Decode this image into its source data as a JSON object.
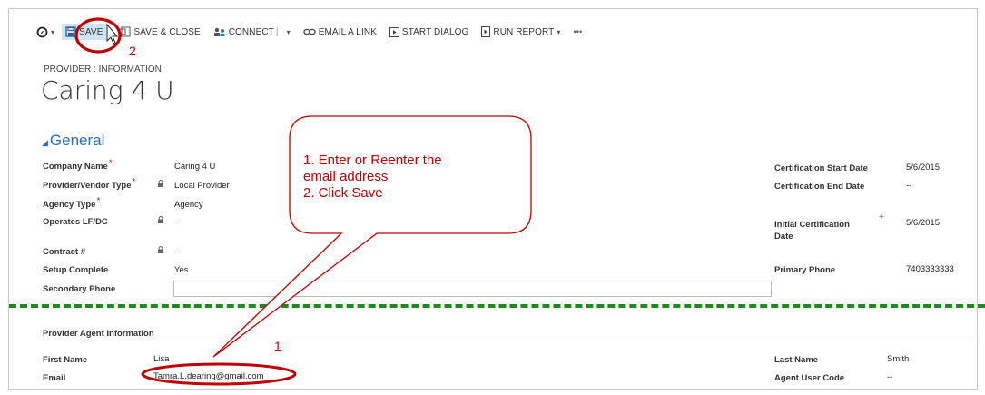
{
  "toolbar": {
    "save": "SAVE",
    "save_close": "SAVE & CLOSE",
    "connect": "CONNECT",
    "email_link": "EMAIL A LINK",
    "start_dialog": "START DIALOG",
    "run_report": "RUN REPORT",
    "more": "•••"
  },
  "header": {
    "entity_label": "PROVIDER : INFORMATION",
    "title": "Caring 4 U"
  },
  "section_general": {
    "title": "General",
    "left": [
      {
        "label": "Company Name",
        "required": "*",
        "value": "Caring 4 U"
      },
      {
        "label": "Provider/Vendor Type",
        "required": "*",
        "value": "Local Provider"
      },
      {
        "label": "Agency Type",
        "required": "*",
        "value": "Agency"
      },
      {
        "label": "Operates LF/DC",
        "value": "--"
      },
      {
        "label": "Contract #",
        "value": "--"
      },
      {
        "label": "Setup Complete",
        "value": "Yes"
      },
      {
        "label": "Secondary Phone",
        "value": ""
      }
    ],
    "right": [
      {
        "label": "Certification Start Date",
        "value": "5/6/2015"
      },
      {
        "label": "Certification End Date",
        "value": "--"
      },
      {
        "label": "Initial Certification Date",
        "recommended": "+",
        "value": "5/6/2015"
      },
      {
        "label": "Primary Phone",
        "value": "7403333333"
      }
    ]
  },
  "section_agent": {
    "title": "Provider Agent Information",
    "first_name_label": "First Name",
    "first_name": "Lisa",
    "email_label": "Email",
    "email": "Tamra.L.dearing@gmail.com",
    "last_name_label": "Last Name",
    "last_name": "Smith",
    "agent_code_label": "Agent User Code",
    "agent_code": "--"
  },
  "annotations": {
    "callout_line1": "1. Enter or Reenter the",
    "callout_line2": "email address",
    "callout_line3": "2. Click Save",
    "num_save": "2",
    "num_email": "1"
  },
  "colors": {
    "annotation_red": "#c00000",
    "dash_green": "#1e8a1e",
    "link_blue": "#2c6fb5",
    "save_highlight": "#cde4f7"
  }
}
